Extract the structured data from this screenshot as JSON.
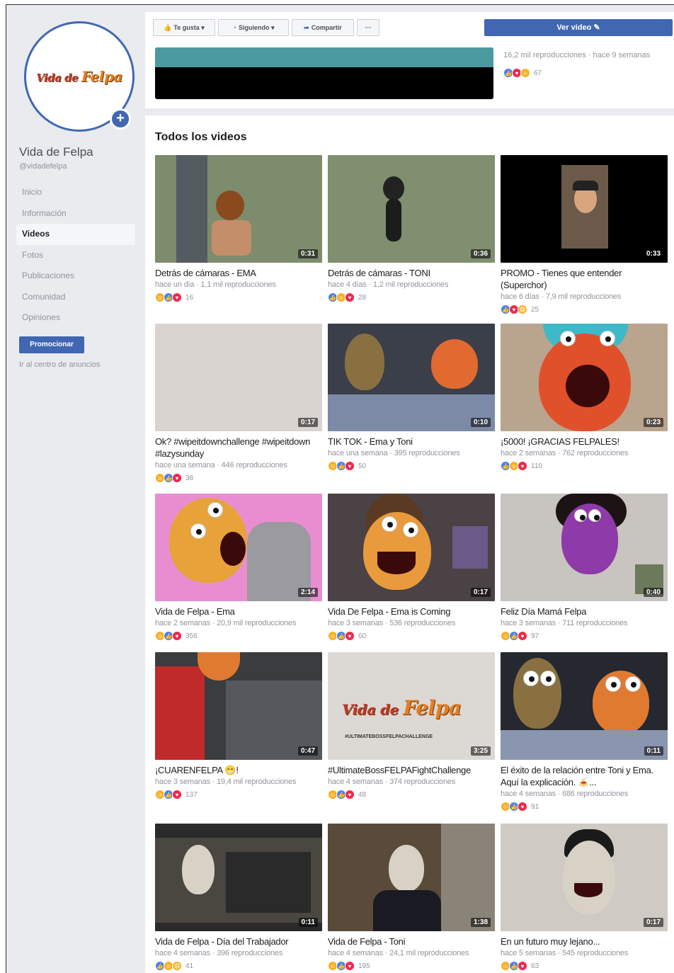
{
  "page": {
    "name": "Vida de Felpa",
    "handle": "@vidadefelpa",
    "logo_text_a": "Vida de",
    "logo_text_b": "Felpa"
  },
  "sidebar": {
    "items": [
      {
        "label": "Inicio",
        "active": false
      },
      {
        "label": "Información",
        "active": false
      },
      {
        "label": "Videos",
        "active": true
      },
      {
        "label": "Fotos",
        "active": false
      },
      {
        "label": "Publicaciones",
        "active": false
      },
      {
        "label": "Comunidad",
        "active": false
      },
      {
        "label": "Opiniones",
        "active": false
      }
    ],
    "promote_label": "Promocionar",
    "ads_center_label": "Ir al centro de anuncios"
  },
  "actionbar": {
    "like_label": "Te gusta ▾",
    "following_label": "Siguiendo ▾",
    "share_label": "Compartir",
    "more_label": "···",
    "video_label": "Ver video ✎"
  },
  "featured": {
    "meta": "16,2 mil reproducciones · hace 9 semanas",
    "reactions": "67"
  },
  "main": {
    "section_title": "Todos los videos",
    "videos": [
      {
        "title": "Detrás de cámaras - EMA",
        "meta": "hace un día · 1,1 mil reproducciones",
        "duration": "0:31",
        "reactions": "16"
      },
      {
        "title": "Detrás de cámaras - TONI",
        "meta": "hace 4 días · 1,2 mil reproducciones",
        "duration": "0:36",
        "reactions": "28"
      },
      {
        "title": "PROMO - Tienes que entender (Superchor)",
        "meta": "hace 6 días · 7,9 mil reproducciones",
        "duration": "0:33",
        "reactions": "25"
      },
      {
        "title": "Ok? #wipeitdownchallenge #wipeitdown #lazysunday",
        "meta": "hace una semana · 446 reproducciones",
        "duration": "0:17",
        "reactions": "38"
      },
      {
        "title": "TIK TOK - Ema y Toni",
        "meta": "hace una semana · 395 reproducciones",
        "duration": "0:10",
        "reactions": "50"
      },
      {
        "title": "¡5000! ¡GRACIAS FELPALES!",
        "meta": "hace 2 semanas · 762 reproducciones",
        "duration": "0:23",
        "reactions": "110"
      },
      {
        "title": "Vida de Felpa - Ema",
        "meta": "hace 2 semanas · 20,9 mil reproducciones",
        "duration": "2:14",
        "reactions": "356"
      },
      {
        "title": "Vida De Felpa - Ema is Coming",
        "meta": "hace 3 semanas · 536 reproducciones",
        "duration": "0:17",
        "reactions": "60"
      },
      {
        "title": "Feliz Día Mamá Felpa",
        "meta": "hace 3 semanas · 711 reproducciones",
        "duration": "0:40",
        "reactions": "97"
      },
      {
        "title": "¡CUARENFELPA 😁!",
        "meta": "hace 3 semanas · 19,4 mil reproducciones",
        "duration": "0:47",
        "reactions": "137"
      },
      {
        "title": "#UltimateBossFELPAFightChallenge",
        "meta": "hace 4 semanas · 374 reproducciones",
        "duration": "3:25",
        "reactions": "48"
      },
      {
        "title": "El éxito de la relación entre Toni y Ema. Aquí la explicación. 🍝...",
        "meta": "hace 4 semanas · 686 reproducciones",
        "duration": "0:11",
        "reactions": "91"
      },
      {
        "title": "Vida de Felpa - Día del Trabajador",
        "meta": "hace 4 semanas · 396 reproducciones",
        "duration": "0:11",
        "reactions": "41"
      },
      {
        "title": "Vida de Felpa - Toni",
        "meta": "hace 4 semanas · 24,1 mil reproducciones",
        "duration": "1:38",
        "reactions": "195"
      },
      {
        "title": "En un futuro muy lejano...",
        "meta": "hace 5 semanas · 545 reproducciones",
        "duration": "0:17",
        "reactions": "63"
      }
    ],
    "overlay_11_text": "#ULTIMATEBOSSFELPACHALLENGE"
  },
  "colors": {
    "accent": "#4267b2",
    "background": "#e9ebee"
  }
}
